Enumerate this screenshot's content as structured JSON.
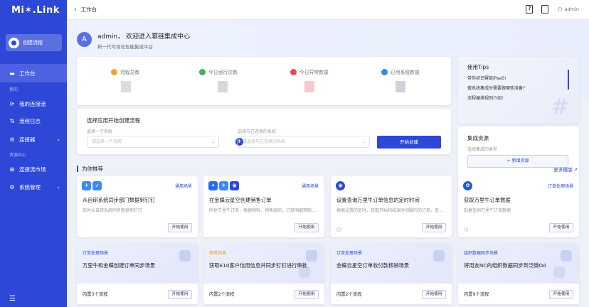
{
  "app": {
    "logo": "Mi✶.Link"
  },
  "sidebar": {
    "create_label": "创建流程",
    "workbench": "工作台",
    "section_mine": "我的",
    "my_connections": "我的连接流",
    "flow_logs": "流程日志",
    "connectors": "连接器",
    "section_resources": "资源中心",
    "market": "连接流市场",
    "system": "系统管理"
  },
  "header": {
    "crumb": "工作台",
    "user": "admin"
  },
  "welcome": {
    "avatar": "A",
    "title": "admin，  欢迎进入幂链集成中心",
    "subtitle": "新一代可视化智能集成平台"
  },
  "stats": [
    {
      "label": "流程总数",
      "color": "#f2a23a"
    },
    {
      "label": "今日运行次数",
      "color": "#3db35a"
    },
    {
      "label": "今日异常数量",
      "color": "#e8475a"
    },
    {
      "label": "已用系统数量",
      "color": "#2f8be6"
    }
  ],
  "tips": {
    "title": "使用Tips",
    "items": [
      "带你初识幂链iPaaS!",
      "做系统集成时需要做哪些准备?",
      "流程编排规则介绍!"
    ]
  },
  "selector": {
    "title": "选择应用开始创建流程",
    "label1": "选择一个系统",
    "placeholder1": "请选择一个系统",
    "label2": "选择与已连接的系统",
    "placeholder2": "请选择与已连接的系统",
    "start": "开始创建"
  },
  "resources": {
    "title": "集成资源",
    "subtitle": "选择集成的类型",
    "add": "+ 新增资源"
  },
  "recommend": {
    "title": "为你推荐",
    "more": "更多模版"
  },
  "templates": [
    {
      "tag": "通用场景",
      "name": "从自研系统同步部门数据到钉钉",
      "desc": "及时从自研系统同步数据到钉钉",
      "use": "开始使用",
      "icons": [
        "#3b8bf0",
        "#3b8bf0"
      ]
    },
    {
      "tag": "通用场景",
      "name": "在金蝶云星空创建销售订单",
      "desc": "同步万里牛订单，根据物料、销售组织、订单明细等映...",
      "use": "开始使用",
      "icons": [
        "#2d6be6",
        "#3b8bf0",
        "#2d47d6"
      ]
    },
    {
      "tag": "",
      "name": "设置查询万里牛订单信息的定时时间",
      "desc": "根据设置的定时，获取开始和结束时间戳内的订单，查...",
      "use": "开始使用",
      "icons": [
        "#2d47d6"
      ]
    },
    {
      "tag": "订单处理场景",
      "name": "获取万里牛订单数据",
      "desc": "批量查询万里牛订单数据",
      "use": "开始使用",
      "icons": [
        "#2157d9"
      ]
    }
  ],
  "scenarios": [
    {
      "category": "订单处理场景",
      "name": "万里牛和金蝶创建订单同步场景",
      "count": "内置3个流程",
      "use": "开始使用"
    },
    {
      "category": "审批场景",
      "name": "获取E10客户信用信息并同步钉钉进行审批",
      "count": "内置2个流程",
      "use": "开始使用"
    },
    {
      "category": "订单处理场景",
      "name": "金蝶云星空订单收付款核销场景",
      "count": "内置2个流程",
      "use": "开始使用"
    },
    {
      "category": "组织数据同步场景",
      "name": "将用友NC的组织数据同步到泛微OA",
      "count": "内置9个流程",
      "use": "开始使用"
    }
  ]
}
